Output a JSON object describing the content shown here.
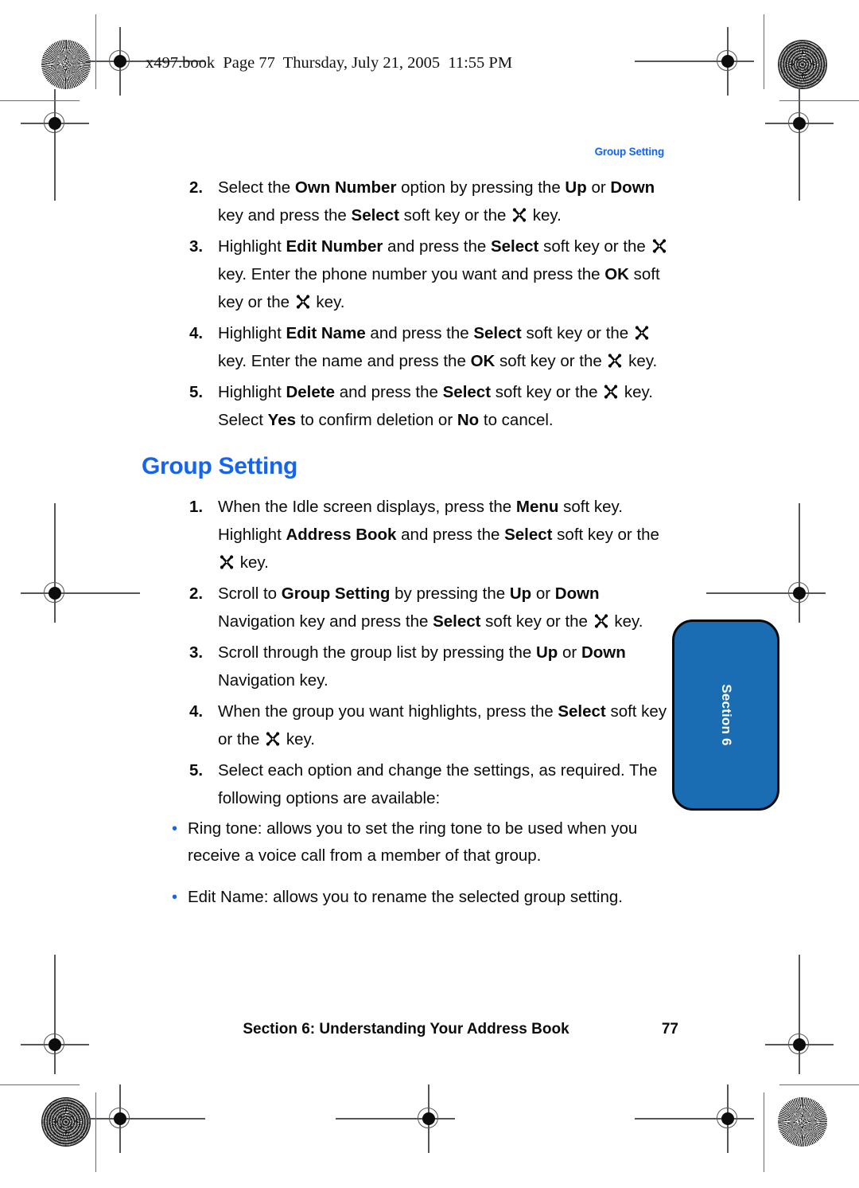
{
  "page_header": "x497.book  Page 77  Thursday, July 21, 2005  11:55 PM",
  "running_head": "Group Setting",
  "section_title": "Group Setting",
  "icons": {
    "nav_key": "navigation-key-icon",
    "reg_target": "registration-target-icon",
    "starburst": "starburst-density-icon",
    "moire": "moire-density-icon"
  },
  "colors": {
    "accent_blue": "#1464ee",
    "tab_blue": "#1a6cb3",
    "text": "#0b0b0b"
  },
  "steps_top": [
    {
      "num": "2.",
      "parts": [
        {
          "t": "Select the "
        },
        {
          "t": "Own Number",
          "b": true
        },
        {
          "t": " option by pressing the "
        },
        {
          "t": "Up",
          "b": true
        },
        {
          "t": " or "
        },
        {
          "t": "Down",
          "b": true
        },
        {
          "t": " key and press the "
        },
        {
          "t": "Select",
          "b": true
        },
        {
          "t": " soft key or the "
        },
        {
          "icon": "nav-key"
        },
        {
          "t": " key."
        }
      ]
    },
    {
      "num": "3.",
      "parts": [
        {
          "t": "Highlight "
        },
        {
          "t": "Edit Number",
          "b": true
        },
        {
          "t": " and press the "
        },
        {
          "t": "Select",
          "b": true
        },
        {
          "t": " soft key or the "
        },
        {
          "icon": "nav-key"
        },
        {
          "t": " key. Enter the phone number you want and press the "
        },
        {
          "t": "OK",
          "b": true
        },
        {
          "t": " soft key or the "
        },
        {
          "icon": "nav-key"
        },
        {
          "t": " key."
        }
      ]
    },
    {
      "num": "4.",
      "parts": [
        {
          "t": "Highlight "
        },
        {
          "t": "Edit Name",
          "b": true
        },
        {
          "t": " and press the "
        },
        {
          "t": "Select",
          "b": true
        },
        {
          "t": " soft key or the "
        },
        {
          "icon": "nav-key"
        },
        {
          "t": " key. Enter the name and press the "
        },
        {
          "t": "OK",
          "b": true
        },
        {
          "t": " soft key or the "
        },
        {
          "icon": "nav-key"
        },
        {
          "t": " key."
        }
      ]
    },
    {
      "num": "5.",
      "parts": [
        {
          "t": "Highlight "
        },
        {
          "t": "Delete",
          "b": true
        },
        {
          "t": " and press the "
        },
        {
          "t": "Select",
          "b": true
        },
        {
          "t": " soft key or the "
        },
        {
          "icon": "nav-key"
        },
        {
          "t": " key. Select "
        },
        {
          "t": "Yes",
          "b": true
        },
        {
          "t": " to confirm deletion or "
        },
        {
          "t": "No",
          "b": true
        },
        {
          "t": " to cancel."
        }
      ]
    }
  ],
  "steps_bottom": [
    {
      "num": "1.",
      "parts": [
        {
          "t": "When the Idle screen displays, press the "
        },
        {
          "t": "Menu",
          "b": true
        },
        {
          "t": " soft key. Highlight "
        },
        {
          "t": "Address Book",
          "b": true
        },
        {
          "t": " and press the "
        },
        {
          "t": "Select",
          "b": true
        },
        {
          "t": " soft key or the "
        },
        {
          "icon": "nav-key"
        },
        {
          "t": " key."
        }
      ]
    },
    {
      "num": "2.",
      "parts": [
        {
          "t": "Scroll to "
        },
        {
          "t": "Group Setting",
          "b": true
        },
        {
          "t": " by pressing the "
        },
        {
          "t": "Up",
          "b": true
        },
        {
          "t": " or "
        },
        {
          "t": "Down",
          "b": true
        },
        {
          "t": " Navigation key and press the "
        },
        {
          "t": "Select",
          "b": true
        },
        {
          "t": " soft key or the "
        },
        {
          "icon": "nav-key"
        },
        {
          "t": " key."
        }
      ]
    },
    {
      "num": "3.",
      "parts": [
        {
          "t": "Scroll through the group list by pressing the "
        },
        {
          "t": "Up",
          "b": true
        },
        {
          "t": " or "
        },
        {
          "t": "Down",
          "b": true
        },
        {
          "t": " Navigation key."
        }
      ]
    },
    {
      "num": "4.",
      "parts": [
        {
          "t": "When the group you want highlights, press the "
        },
        {
          "t": "Select",
          "b": true
        },
        {
          "t": " soft key or the "
        },
        {
          "icon": "nav-key"
        },
        {
          "t": " key."
        }
      ]
    },
    {
      "num": "5.",
      "parts": [
        {
          "t": "Select each option and change the settings, as required. The following options are available:"
        }
      ]
    }
  ],
  "bullets": [
    "Ring tone: allows you to set the ring tone to be used when you receive a voice call from a member of that group.",
    "Edit Name: allows you to rename the selected group setting."
  ],
  "bullet_char": "•",
  "side_tab": {
    "label": "Section 6"
  },
  "footer": {
    "title": "Section 6: Understanding Your Address Book",
    "page": "77"
  }
}
